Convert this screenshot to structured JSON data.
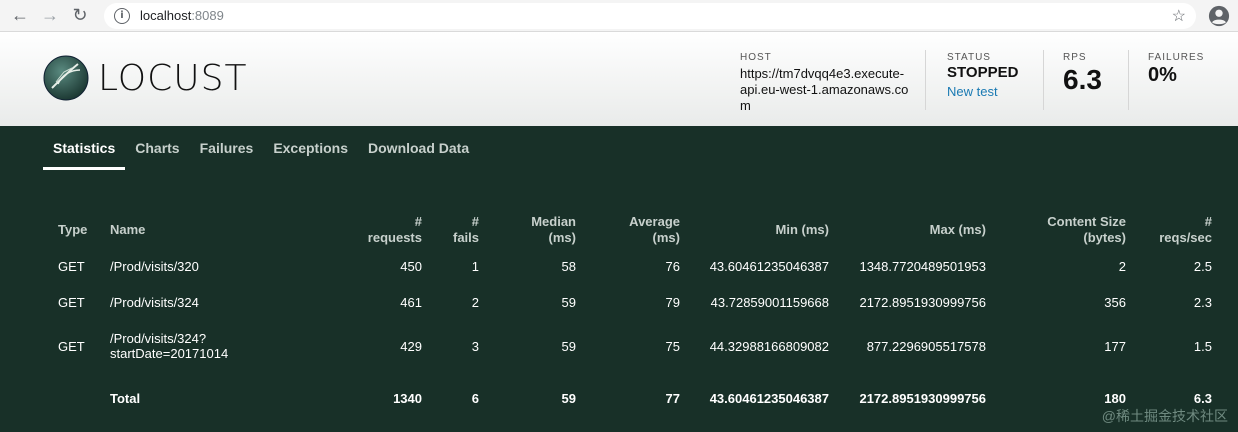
{
  "browser": {
    "url_host": "localhost",
    "url_port": ":8089"
  },
  "app": {
    "logo_text": "LOCUST"
  },
  "header": {
    "host_label": "HOST",
    "host_value": "https://tm7dvqq4e3.execute-api.eu-west-1.amazonaws.com",
    "status_label": "STATUS",
    "status_value": "STOPPED",
    "new_test_label": "New test",
    "rps_label": "RPS",
    "rps_value": "6.3",
    "failures_label": "FAILURES",
    "failures_value": "0%"
  },
  "tabs": [
    {
      "label": "Statistics",
      "active": true
    },
    {
      "label": "Charts",
      "active": false
    },
    {
      "label": "Failures",
      "active": false
    },
    {
      "label": "Exceptions",
      "active": false
    },
    {
      "label": "Download Data",
      "active": false
    }
  ],
  "table": {
    "headers": {
      "type": "Type",
      "name": "Name",
      "requests_1": "#",
      "requests_2": "requests",
      "fails_1": "#",
      "fails_2": "fails",
      "median_1": "Median",
      "median_2": "(ms)",
      "average_1": "Average",
      "average_2": "(ms)",
      "min": "Min (ms)",
      "max": "Max (ms)",
      "content_1": "Content Size",
      "content_2": "(bytes)",
      "reqs_1": "#",
      "reqs_2": "reqs/sec"
    },
    "rows": [
      {
        "type": "GET",
        "name_1": "/Prod/visits/320",
        "name_2": "",
        "requests": "450",
        "fails": "1",
        "median": "58",
        "average": "76",
        "min": "43.60461235046387",
        "max": "1348.7720489501953",
        "content": "2",
        "reqs": "2.5"
      },
      {
        "type": "GET",
        "name_1": "/Prod/visits/324",
        "name_2": "",
        "requests": "461",
        "fails": "2",
        "median": "59",
        "average": "79",
        "min": "43.72859001159668",
        "max": "2172.8951930999756",
        "content": "356",
        "reqs": "2.3"
      },
      {
        "type": "GET",
        "name_1": "/Prod/visits/324?",
        "name_2": "startDate=20171014",
        "requests": "429",
        "fails": "3",
        "median": "59",
        "average": "75",
        "min": "44.32988166809082",
        "max": "877.2296905517578",
        "content": "177",
        "reqs": "1.5"
      }
    ],
    "total": {
      "type": "",
      "name": "Total",
      "requests": "1340",
      "fails": "6",
      "median": "59",
      "average": "77",
      "min": "43.60461235046387",
      "max": "2172.8951930999756",
      "content": "180",
      "reqs": "6.3"
    }
  },
  "watermark": "@稀土掘金技术社区"
}
